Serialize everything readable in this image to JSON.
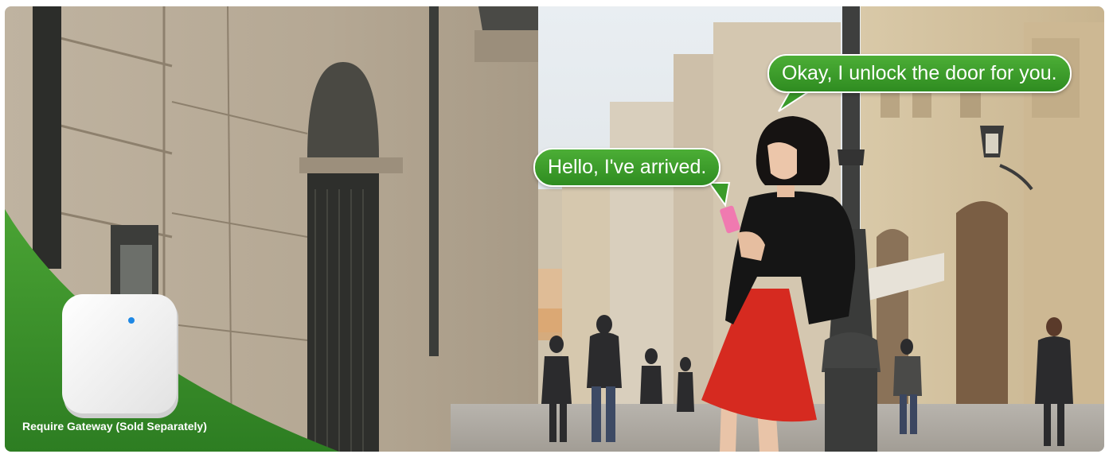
{
  "speech": {
    "door_reply": "Okay, I unlock the door for you.",
    "arrival_message": "Hello, I've arrived."
  },
  "promo": {
    "gateway_note": "Require Gateway (Sold Separately)"
  },
  "colors": {
    "bubble_green": "#3a9b2a",
    "corner_green": "#3f9a2c",
    "skirt_red": "#d62a20",
    "phone_pink": "#f07ab0",
    "jacket_black": "#151515",
    "device_white": "#f4f4f4",
    "led_blue": "#1e88e5"
  },
  "icons": {
    "gateway_device": "white-square-gateway-with-blue-led"
  }
}
